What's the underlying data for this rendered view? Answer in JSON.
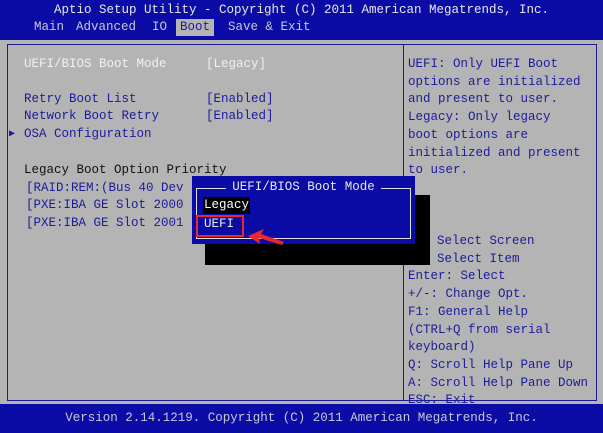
{
  "header": {
    "title": "Aptio Setup Utility - Copyright (C) 2011 American Megatrends, Inc.",
    "tabs": [
      {
        "label": "Main"
      },
      {
        "label": "Advanced"
      },
      {
        "label": "IO"
      },
      {
        "label": "Boot",
        "active": true
      },
      {
        "label": "Save & Exit"
      }
    ]
  },
  "settings": {
    "boot_mode": {
      "label": "UEFI/BIOS Boot Mode",
      "value": "[Legacy]"
    },
    "retry_boot_list": {
      "label": "Retry Boot List",
      "value": "[Enabled]"
    },
    "network_boot_retry": {
      "label": "Network Boot Retry",
      "value": "[Enabled]"
    },
    "osa_configuration": {
      "label": "OSA Configuration"
    },
    "legacy_priority_heading": "Legacy Boot Option Priority",
    "legacy_options": [
      "[RAID:REM:(Bus 40 Dev",
      "[PXE:IBA GE Slot 2000",
      "[PXE:IBA GE Slot 2001"
    ]
  },
  "help": {
    "description": [
      "UEFI: Only UEFI Boot",
      "options are initialized",
      "and present to user.",
      "Legacy: Only legacy",
      "boot options are",
      "initialized and present",
      "to user."
    ],
    "keys": [
      "Select Screen",
      "Select Item",
      "Enter: Select",
      "+/-: Change Opt.",
      "F1: General Help",
      "(CTRL+Q from serial",
      "keyboard)",
      "Q: Scroll Help Pane Up",
      "A: Scroll Help Pane Down",
      "ESC: Exit"
    ]
  },
  "popup": {
    "title": "UEFI/BIOS Boot Mode",
    "options": [
      "Legacy",
      "UEFI"
    ],
    "highlighted": "UEFI"
  },
  "annotation_color": "#e8282a",
  "footer": {
    "version": "Version 2.14.1219. Copyright (C) 2011 American Megatrends, Inc."
  }
}
